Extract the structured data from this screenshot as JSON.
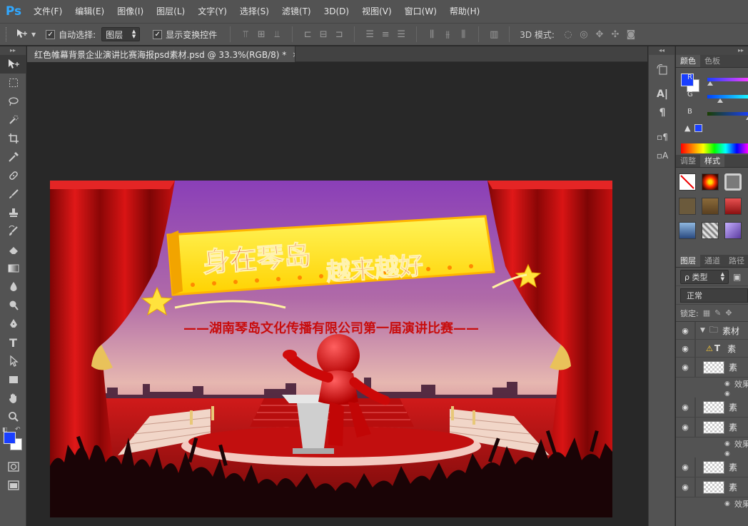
{
  "app": {
    "logo": "Ps",
    "menu": [
      "文件(F)",
      "编辑(E)",
      "图像(I)",
      "图层(L)",
      "文字(Y)",
      "选择(S)",
      "滤镜(T)",
      "3D(D)",
      "视图(V)",
      "窗口(W)",
      "帮助(H)"
    ]
  },
  "options": {
    "auto_select_label": "自动选择:",
    "auto_select_value": "图层",
    "show_transform_label": "显示变换控件",
    "mode3d_label": "3D 模式:"
  },
  "document": {
    "tab_title": "红色帷幕背景企业演讲比赛海报psd素材.psd @ 33.3%(RGB/8) *",
    "close": "×"
  },
  "artwork": {
    "headline_1": "身在琴岛",
    "headline_2": "越来越好",
    "subtitle": "——湖南琴岛文化传播有限公司第一届演讲比赛——"
  },
  "colors": {
    "foreground": "#1a3fff",
    "background": "#ffffff"
  },
  "color_panel": {
    "tabs": [
      "颜色",
      "色板"
    ],
    "channels": [
      "R",
      "G",
      "B"
    ]
  },
  "styles_panel": {
    "tabs": [
      "调整",
      "样式"
    ]
  },
  "layers_panel": {
    "tabs": [
      "图层",
      "通道",
      "路径"
    ],
    "filter_label": "ρ 类型",
    "blend_mode": "正常",
    "lock_label": "锁定:",
    "layers": [
      {
        "type": "group",
        "name": "素材"
      },
      {
        "type": "text",
        "name": "素"
      },
      {
        "type": "image",
        "name": "素",
        "effect": "效果"
      },
      {
        "type": "image",
        "name": "素"
      },
      {
        "type": "image",
        "name": "素",
        "effect": "效果"
      },
      {
        "type": "image",
        "name": "素"
      },
      {
        "type": "image",
        "name": "素",
        "effect": "效果"
      }
    ]
  }
}
